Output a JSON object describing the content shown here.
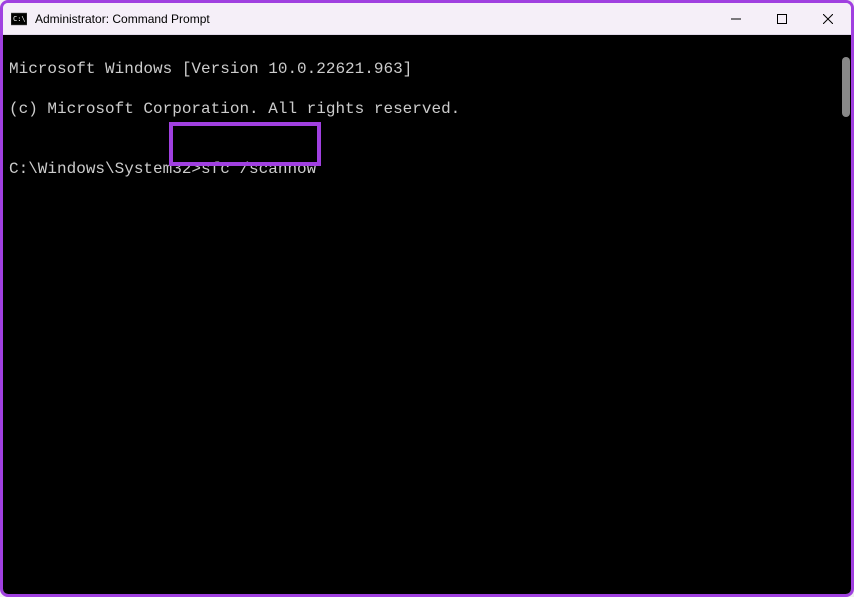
{
  "window": {
    "title": "Administrator: Command Prompt"
  },
  "terminal": {
    "line1": "Microsoft Windows [Version 10.0.22621.963]",
    "line2": "(c) Microsoft Corporation. All rights reserved.",
    "line3": "",
    "prompt": "C:\\Windows\\System32>",
    "command": "sfc /scannow"
  },
  "colors": {
    "highlight": "#a040e0",
    "titlebar": "#f5eff8",
    "terminal_bg": "#000000",
    "terminal_fg": "#cccccc"
  }
}
